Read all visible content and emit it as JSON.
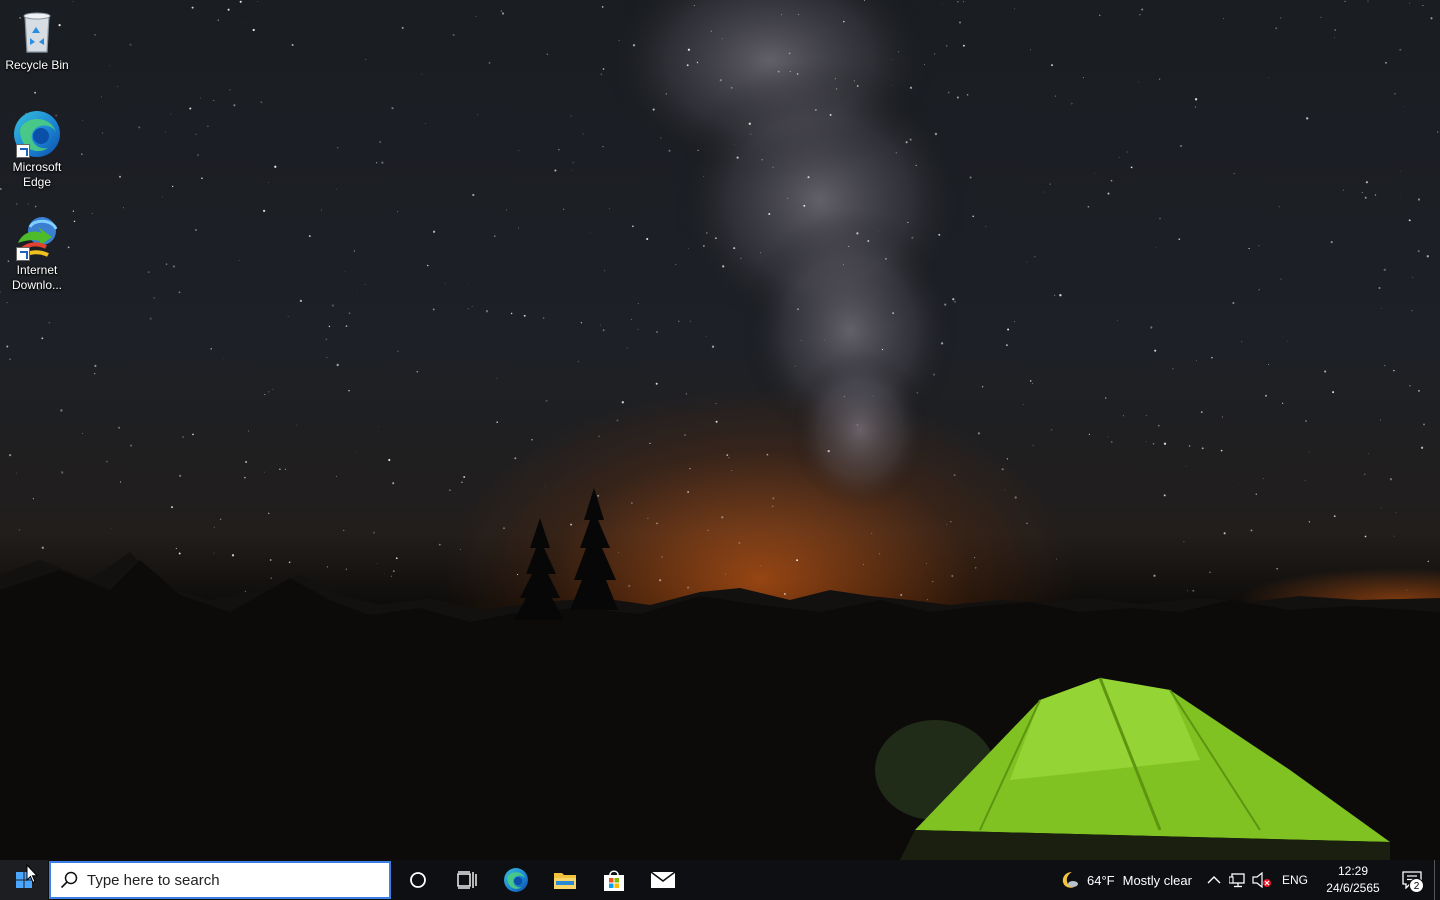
{
  "desktop": {
    "icons": [
      {
        "label": "Recycle Bin",
        "icon": "recycle-bin-icon"
      },
      {
        "label": "Microsoft Edge",
        "icon": "edge-icon"
      },
      {
        "label": "Internet Downlo...",
        "icon": "internet-download-manager-icon"
      }
    ]
  },
  "taskbar": {
    "start_icon": "windows-logo-icon",
    "search": {
      "placeholder": "Type here to search",
      "value": ""
    },
    "pinned": [
      {
        "name": "cortana",
        "icon": "circle-icon"
      },
      {
        "name": "task-view",
        "icon": "task-view-icon"
      },
      {
        "name": "microsoft-edge",
        "icon": "edge-icon"
      },
      {
        "name": "file-explorer",
        "icon": "folder-icon"
      },
      {
        "name": "microsoft-store",
        "icon": "store-bag-icon"
      },
      {
        "name": "mail",
        "icon": "envelope-icon"
      }
    ],
    "weather": {
      "temp": "64°F",
      "condition": "Mostly clear",
      "icon": "moon-icon"
    },
    "tray": {
      "chevron_icon": "chevron-up-icon",
      "network_icon": "network-icon",
      "volume_icon": "volume-muted-icon",
      "language": "ENG"
    },
    "clock": {
      "time": "12:29",
      "date": "24/6/2565"
    },
    "notifications": {
      "count": "2",
      "icon": "action-center-icon"
    }
  },
  "colors": {
    "taskbar_bg": "#0e0f12",
    "search_border": "#3c7ee6",
    "tent_green": "#8fd12a",
    "horizon_glow": "#ff6e14"
  }
}
